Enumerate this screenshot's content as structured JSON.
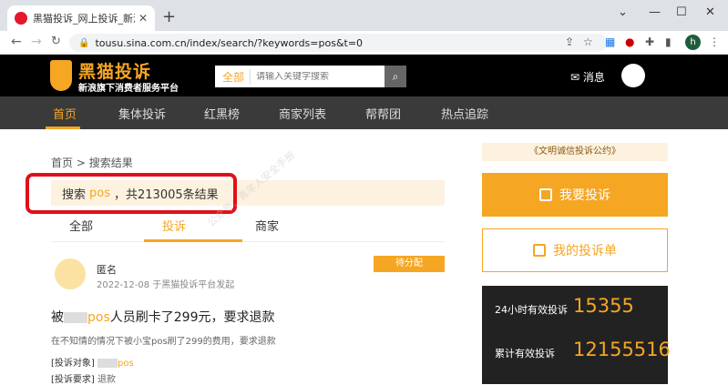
{
  "browser": {
    "tab_title": "黑猫投诉_网上投诉_新浪旗下消费",
    "url": "tousu.sina.com.cn/index/search/?keywords=pos&t=0",
    "profile_initial": "h"
  },
  "header": {
    "logo_title": "黑猫投诉",
    "logo_subtitle": "新浪旗下消费者服务平台",
    "search_category": "全部",
    "search_placeholder": "请输入关键字搜索",
    "message_label": "消息"
  },
  "menu": {
    "items": [
      "首页",
      "集体投诉",
      "红黑榜",
      "商家列表",
      "帮帮团",
      "热点追踪"
    ]
  },
  "breadcrumb": {
    "home": "首页",
    "separator": ">",
    "current": "搜索结果"
  },
  "search_result": {
    "prefix": "搜索",
    "keyword": "pos",
    "suffix": "，共213005条结果"
  },
  "result_tabs": [
    "全部",
    "投诉",
    "商家"
  ],
  "card": {
    "name": "匿名",
    "date": "2022-12-08 于黑猫投诉平台发起",
    "badge": "待分配",
    "title_prefix": "被",
    "title_keyword": "pos",
    "title_suffix": "人员刷卡了299元，要求退款",
    "description": "在不知情的情况下被小宝pos刷了299的费用，要求退款",
    "object_label": "[投诉对象]",
    "object_value": "pos",
    "request_label": "[投诉要求]",
    "request_value": "退款"
  },
  "sidebar": {
    "convention": "《文明诚信投诉公约》",
    "complain_button": "我要投诉",
    "my_list_button": "我的投诉单",
    "stat1_label": "24小时有效投诉",
    "stat1_value": "15355",
    "stat2_label": "累计有效投诉",
    "stat2_value": "12155516"
  },
  "watermark": "公众号：青年人安全手册",
  "colors": {
    "accent": "#f5a623",
    "highlight_frame": "#e0101a"
  }
}
